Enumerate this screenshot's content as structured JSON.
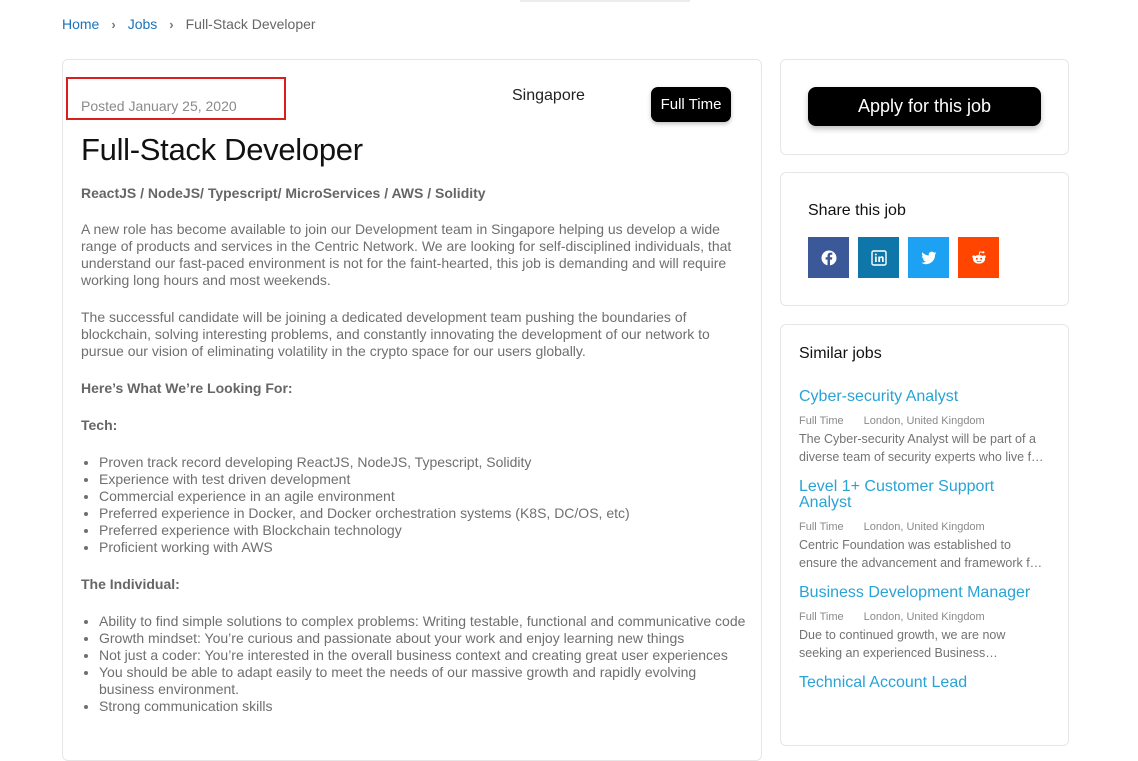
{
  "breadcrumb": {
    "home": "Home",
    "jobs": "Jobs",
    "current": "Full-Stack Developer"
  },
  "job": {
    "posted": "Posted January 25, 2020",
    "location": "Singapore",
    "type_badge": "Full Time",
    "title": "Full-Stack Developer",
    "tags": "ReactJS / NodeJS/ Typescript/ MicroServices / AWS / Solidity",
    "paragraph1": "A new role has become available to join our Development team in Singapore helping us develop a wide range of products and services in the Centric Network. We are looking for self-disciplined individuals, that understand our fast-paced environment is not for the faint-hearted, this job is demanding and will require working long hours and most weekends.",
    "paragraph2": "The successful candidate will be joining a dedicated development team pushing the boundaries of blockchain, solving interesting problems, and constantly innovating the development of our network to pursue our vision of eliminating volatility in the crypto space for our users globally.",
    "looking_heading": "Here’s What We’re Looking For:",
    "tech_heading": "Tech:",
    "tech_items": [
      "Proven track record developing ReactJS, NodeJS, Typescript, Solidity",
      "Experience with test driven development",
      "Commercial experience in an agile environment",
      "Preferred experience in Docker, and Docker orchestration systems (K8S, DC/OS, etc)",
      "Preferred experience with Blockchain technology",
      "Proficient working with AWS"
    ],
    "individual_heading": "The Individual:",
    "individual_items": [
      "Ability to find simple solutions to complex problems: Writing testable, functional and communicative code",
      "Growth mindset: You’re curious and passionate about your work and enjoy learning new things",
      "Not just a coder: You’re interested in the overall business context and creating great user experiences",
      "You should be able to adapt easily to meet the needs of our massive growth and rapidly evolving business environment.",
      "Strong communication skills"
    ]
  },
  "sidebar": {
    "apply_label": "Apply for this job",
    "share_title": "Share this job",
    "share_icons": [
      "facebook-icon",
      "linkedin-icon",
      "twitter-icon",
      "reddit-icon"
    ],
    "similar_title": "Similar jobs",
    "similar_jobs": [
      {
        "title": "Cyber-security Analyst",
        "type": "Full Time",
        "location": "London, United Kingdom",
        "desc": "The Cyber-security Analyst will be part of a diverse team of security experts who live f…"
      },
      {
        "title": "Level 1+ Customer Support Analyst",
        "type": "Full Time",
        "location": "London, United Kingdom",
        "desc": "Centric Foundation was established to ensure the advancement and framework f…"
      },
      {
        "title": "Business Development Manager",
        "type": "Full Time",
        "location": "London, United Kingdom",
        "desc": "Due to continued growth, we are now seeking an experienced Business…"
      },
      {
        "title": "Technical Account Lead",
        "type": "",
        "location": "",
        "desc": ""
      }
    ]
  },
  "colors": {
    "link": "#1a73b9",
    "similar_link": "#29a3d6",
    "highlight_border": "#d91e1e",
    "facebook": "#3b5998",
    "linkedin": "#0e76a8",
    "twitter": "#1da1f2",
    "reddit": "#ff4500"
  }
}
